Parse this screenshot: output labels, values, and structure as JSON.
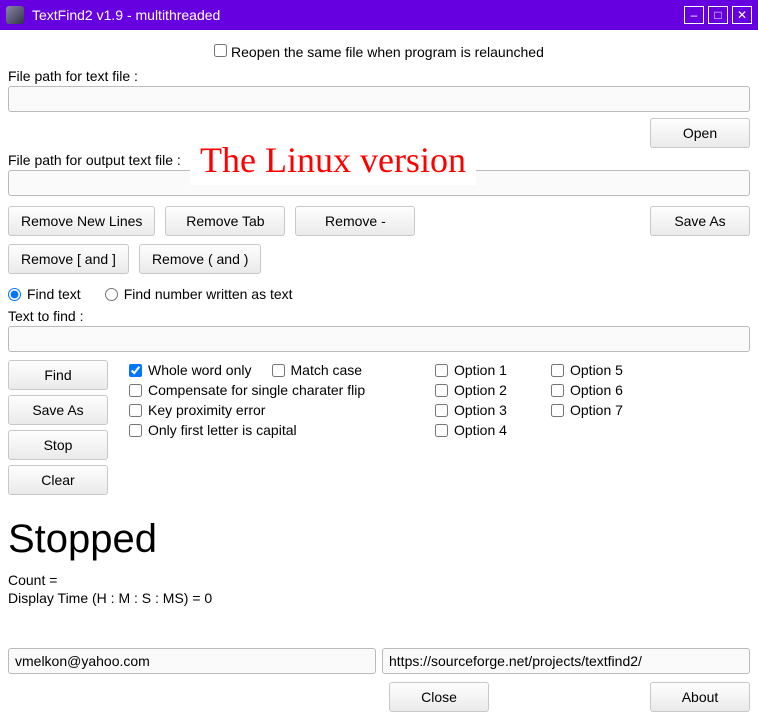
{
  "window": {
    "title": "TextFind2 v1.9 - multithreaded"
  },
  "reopen": {
    "label": "Reopen the same file when program is relaunched",
    "checked": false
  },
  "file_in": {
    "label": "File path for text file :",
    "value": ""
  },
  "file_out": {
    "label": "File path for output text file :",
    "value": ""
  },
  "banner": "The Linux version",
  "buttons": {
    "open": "Open",
    "save_as_top": "Save As",
    "remove_newlines": "Remove New Lines",
    "remove_tab": "Remove Tab",
    "remove_dash": "Remove -",
    "remove_brackets": "Remove [ and ]",
    "remove_parens": "Remove ( and )",
    "find": "Find",
    "save_as": "Save As",
    "stop": "Stop",
    "clear": "Clear",
    "close": "Close",
    "about": "About"
  },
  "mode": {
    "find_text": "Find text",
    "find_number": "Find number written as text",
    "selected": "find_text"
  },
  "to_find": {
    "label": "Text to find :",
    "value": ""
  },
  "checks": {
    "whole_word": {
      "label": "Whole word only",
      "checked": true
    },
    "match_case": {
      "label": "Match case",
      "checked": false
    },
    "comp_flip": {
      "label": "Compensate for single charater flip",
      "checked": false
    },
    "key_prox": {
      "label": "Key proximity error",
      "checked": false
    },
    "first_cap": {
      "label": "Only first letter is capital",
      "checked": false
    }
  },
  "extra_options": {
    "col1": [
      "Option 1",
      "Option 2",
      "Option 3",
      "Option 4"
    ],
    "col2": [
      "Option 5",
      "Option 6",
      "Option 7"
    ]
  },
  "status": {
    "main": "Stopped",
    "count": "Count =",
    "time": "Display Time (H : M : S : MS) = 0"
  },
  "footer": {
    "email": "vmelkon@yahoo.com",
    "url": "https://sourceforge.net/projects/textfind2/"
  }
}
